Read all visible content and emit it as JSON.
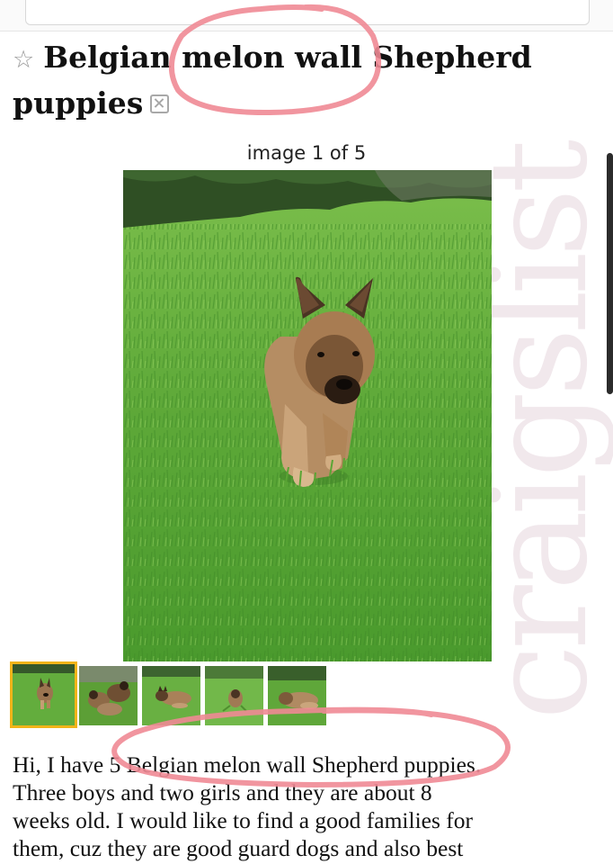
{
  "listing": {
    "title": "Belgian melon wall Shepherd puppies",
    "title_line1": "Belgian melon wall Shepherd",
    "title_line2": "puppies",
    "image_counter": "image 1 of 5",
    "image_index": 1,
    "image_total": 5,
    "thumbnails": [
      {
        "label": "puppy walking on grass",
        "selected": true
      },
      {
        "label": "puppies playing",
        "selected": false
      },
      {
        "label": "puppy lying on grass",
        "selected": false
      },
      {
        "label": "puppy in grass",
        "selected": false
      },
      {
        "label": "puppy resting on grass",
        "selected": false
      }
    ],
    "description_lines": [
      "Hi, I have 5 Belgian melon wall Shepherd puppies.",
      "Three boys and two girls and they are about 8",
      "weeks old. I would like to find a good families for",
      "them, cuz they are good guard dogs and also best"
    ]
  },
  "watermark": "craigslist",
  "icons": {
    "favorite": "star-icon",
    "hide": "hide-icon"
  },
  "colors": {
    "selected_thumb_border": "#f0b419",
    "annotation_circle": "#f08a95",
    "watermark": "#f1e8ec"
  }
}
